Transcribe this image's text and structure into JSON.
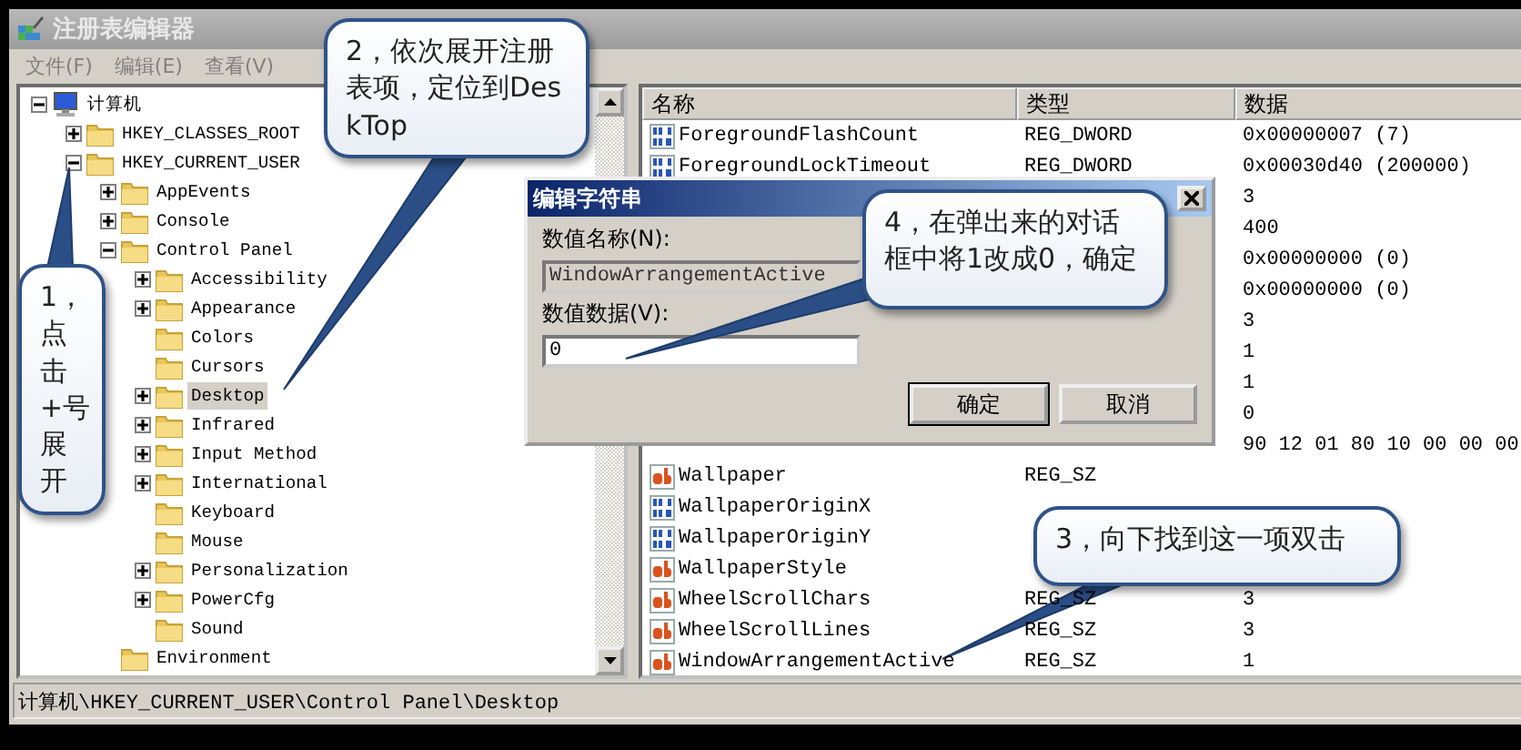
{
  "window": {
    "title": "注册表编辑器"
  },
  "menu": [
    {
      "label": "文件(F)"
    },
    {
      "label": "编辑(E)"
    },
    {
      "label": "查看(V)"
    }
  ],
  "tree": {
    "items": [
      {
        "label": "计算机",
        "kind": "computer",
        "expandable": true,
        "expanded": true,
        "selected": false,
        "children": [
          {
            "label": "HKEY_CLASSES_ROOT",
            "kind": "folder",
            "expandable": true,
            "expanded": false,
            "selected": false
          },
          {
            "label": "HKEY_CURRENT_USER",
            "kind": "folder",
            "expandable": true,
            "expanded": true,
            "selected": false,
            "children": [
              {
                "label": "AppEvents",
                "kind": "folder",
                "expandable": true,
                "expanded": false,
                "selected": false
              },
              {
                "label": "Console",
                "kind": "folder",
                "expandable": true,
                "expanded": false,
                "selected": false
              },
              {
                "label": "Control Panel",
                "kind": "folder",
                "expandable": true,
                "expanded": true,
                "selected": false,
                "children": [
                  {
                    "label": "Accessibility",
                    "kind": "folder",
                    "expandable": true,
                    "expanded": false,
                    "selected": false
                  },
                  {
                    "label": "Appearance",
                    "kind": "folder",
                    "expandable": true,
                    "expanded": false,
                    "selected": false
                  },
                  {
                    "label": "Colors",
                    "kind": "folder",
                    "expandable": false,
                    "selected": false
                  },
                  {
                    "label": "Cursors",
                    "kind": "folder",
                    "expandable": false,
                    "selected": false
                  },
                  {
                    "label": "Desktop",
                    "kind": "folder",
                    "expandable": true,
                    "expanded": false,
                    "selected": true
                  },
                  {
                    "label": "Infrared",
                    "kind": "folder",
                    "expandable": true,
                    "expanded": false,
                    "selected": false
                  },
                  {
                    "label": "Input Method",
                    "kind": "folder",
                    "expandable": true,
                    "expanded": false,
                    "selected": false
                  },
                  {
                    "label": "International",
                    "kind": "folder",
                    "expandable": true,
                    "expanded": false,
                    "selected": false
                  },
                  {
                    "label": "Keyboard",
                    "kind": "folder",
                    "expandable": false,
                    "selected": false
                  },
                  {
                    "label": "Mouse",
                    "kind": "folder",
                    "expandable": false,
                    "selected": false
                  },
                  {
                    "label": "Personalization",
                    "kind": "folder",
                    "expandable": true,
                    "expanded": false,
                    "selected": false
                  },
                  {
                    "label": "PowerCfg",
                    "kind": "folder",
                    "expandable": true,
                    "expanded": false,
                    "selected": false
                  },
                  {
                    "label": "Sound",
                    "kind": "folder",
                    "expandable": false,
                    "selected": false
                  }
                ]
              },
              {
                "label": "Environment",
                "kind": "folder",
                "expandable": false,
                "selected": false
              }
            ]
          }
        ]
      }
    ]
  },
  "list": {
    "columns": [
      "名称",
      "类型",
      "数据"
    ],
    "rows": [
      {
        "kind": "dword",
        "name": "ForegroundFlashCount",
        "type": "REG_DWORD",
        "data": "0x00000007 (7)"
      },
      {
        "kind": "dword",
        "name": "ForegroundLockTimeout",
        "type": "REG_DWORD",
        "data": "0x00030d40 (200000)"
      },
      {
        "data": "3"
      },
      {
        "data": "400"
      },
      {
        "data": "0x00000000 (0)"
      },
      {
        "data": "0x00000000 (0)"
      },
      {
        "data": "3"
      },
      {
        "data": "1"
      },
      {
        "data": "1"
      },
      {
        "data": "0"
      },
      {
        "data": "90 12 01 80 10 00 00 00"
      },
      {
        "kind": "string",
        "name": "Wallpaper",
        "type": "REG_SZ"
      },
      {
        "kind": "dword",
        "name": "WallpaperOriginX"
      },
      {
        "kind": "dword",
        "name": "WallpaperOriginY"
      },
      {
        "kind": "string",
        "name": "WallpaperStyle"
      },
      {
        "kind": "string",
        "name": "WheelScrollChars",
        "type": "REG_SZ",
        "data": "3"
      },
      {
        "kind": "string",
        "name": "WheelScrollLines",
        "type": "REG_SZ",
        "data": "3"
      },
      {
        "kind": "string",
        "name": "WindowArrangementActive",
        "type": "REG_SZ",
        "data": "1"
      }
    ]
  },
  "status_bar": "计算机\\HKEY_CURRENT_USER\\Control Panel\\Desktop",
  "dialog": {
    "title": "编辑字符串",
    "fields": [
      {
        "label": "数值名称(N):",
        "value": "WindowArrangementActive",
        "disabled": true
      },
      {
        "label": "数值数据(V):",
        "value": "0",
        "disabled": false
      }
    ],
    "buttons": [
      {
        "label": "确定",
        "default": true
      },
      {
        "label": "取消",
        "default": false
      }
    ]
  },
  "callouts": [
    {
      "text": "1，点击+号展开"
    },
    {
      "text": "2，依次展开注册表项，定位到DeskTop"
    },
    {
      "text": "3，向下找到这一项双击"
    },
    {
      "text": "4，在弹出来的对话框中将1改成0，确定"
    }
  ]
}
